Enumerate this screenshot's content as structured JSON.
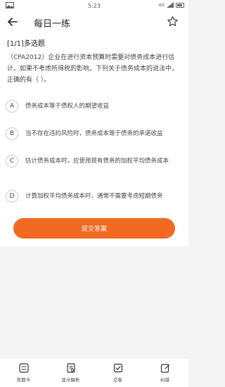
{
  "status_bar": {
    "time": "5:23",
    "network": "4G",
    "battery_label": "battery"
  },
  "header": {
    "title": "每日一练"
  },
  "question": {
    "type_label": "[1/1]多选题",
    "text": "（CPA2012）企业在进行资本预算时需要对债务成本进行估计。如果不考虑所得税的影响，下列关于债务成本的说法中，正确的有（ ）。",
    "options": [
      {
        "letter": "A",
        "text": "债务成本等于债权人的期望收益"
      },
      {
        "letter": "B",
        "text": "当不存在违约风险时，债务成本等于债务的承诺收益"
      },
      {
        "letter": "C",
        "text": "估计债务成本时，应使用现有债务的加权平均债务成本"
      },
      {
        "letter": "D",
        "text": "计算加权平均债务成本时，通常不需要考虑短期债务"
      }
    ]
  },
  "submit_label": "提交答案",
  "bottom_tabs": [
    {
      "label": "答题卡",
      "icon": "grid-icon"
    },
    {
      "label": "显示解析",
      "icon": "document-icon"
    },
    {
      "label": "交卷",
      "icon": "check-icon"
    },
    {
      "label": "纠错",
      "icon": "edit-icon"
    }
  ],
  "colors": {
    "accent": "#f26a21",
    "background": "#f4f4f4"
  }
}
